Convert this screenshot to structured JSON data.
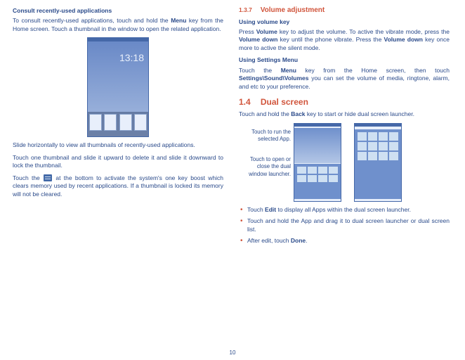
{
  "page_number": "10",
  "left": {
    "heading": "Consult recently-used applications",
    "p1a": "To consult recently-used applications, touch and hold the ",
    "p1b": "Menu",
    "p1c": " key from the Home screen. Touch a thumbnail in the window to open the related application.",
    "clock": "13:18",
    "p2": "Slide horizontally to view all thumbnails of recently-used applications.",
    "p3": "Touch one thumbnail and slide it upward to delete it and slide it downward to lock the thumbnail.",
    "p4a": "Touch the ",
    "p4b": " at the bottom to activate the system's one key boost which clears memory used by recent applications. If a thumbnail is locked its memory will not be cleared."
  },
  "right": {
    "sec1_num": "1.3.7",
    "sec1_title": "Volume adjustment",
    "sub1": "Using volume key",
    "p1a": "Press ",
    "p1b": "Volume",
    "p1c": " key to adjust the volume. To active the vibrate mode, press the ",
    "p1d": "Volume down",
    "p1e": " key until the phone vibrate. Press the ",
    "p1f": "Volume down",
    "p1g": " key once more to active the silent mode.",
    "sub2": "Using Settings Menu",
    "p2a": "Touch the ",
    "p2b": "Menu",
    "p2c": " key from the Home screen, then touch ",
    "p2d": "Settings\\Sound\\Volumes",
    "p2e": " you can set the volume of media, ringtone, alarm, and etc to your preference.",
    "sec2_num": "1.4",
    "sec2_title": "Dual screen",
    "p3a": "Touch and hold the ",
    "p3b": "Back",
    "p3c": " key to start or hide dual screen launcher.",
    "callout1": "Touch to run the selected App.",
    "callout2": "Touch to open or close the dual window launcher.",
    "b1a": "Touch ",
    "b1b": "Edit",
    "b1c": " to display all Apps within the dual screen launcher.",
    "b2": "Touch and hold the App and drag it to dual screen launcher or dual screen list.",
    "b3a": "After edit, touch ",
    "b3b": "Done",
    "b3c": "."
  }
}
